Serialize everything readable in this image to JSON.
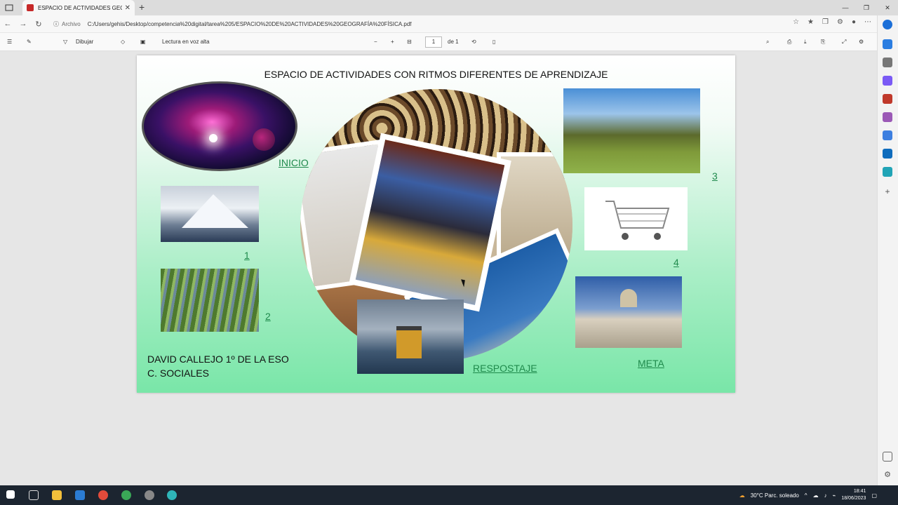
{
  "browser": {
    "tab_title": "ESPACIO DE ACTIVIDADES GEOG",
    "new_tab": "+",
    "window_buttons": [
      "—",
      "❐",
      "✕"
    ],
    "address_label": "Archivo",
    "url": "C:/Users/gehis/Desktop/competencia%20digital/tarea%205/ESPACIO%20DE%20ACTIVIDADES%20GEOGRAFÍA%20FÍSICA.pdf"
  },
  "pdf_toolbar": {
    "draw_label": "Dibujar",
    "read_aloud_label": "Lectura en voz alta",
    "zoom_out": "−",
    "zoom_in": "+",
    "page_value": "1",
    "page_total": "de 1"
  },
  "document": {
    "title": "ESPACIO DE ACTIVIDADES CON RITMOS DIFERENTES DE APRENDIZAJE",
    "start_link": "INICIO",
    "num_1": "1",
    "num_2": "2",
    "num_3": "3",
    "num_4": "4",
    "refuel_link": "RESPOSTAJE",
    "goal_link": "META",
    "author_line1": "DAVID CALLEJO 1º  DE LA ESO",
    "author_line2": "C. SOCIALES"
  },
  "taskbar": {
    "weather": "30°C  Parc. soleado",
    "time": "18:41",
    "date": "18/06/2023"
  },
  "colors": {
    "link": "#1f8a4c",
    "page_bottom": "#79e6a8",
    "taskbar": "#1c2530"
  }
}
